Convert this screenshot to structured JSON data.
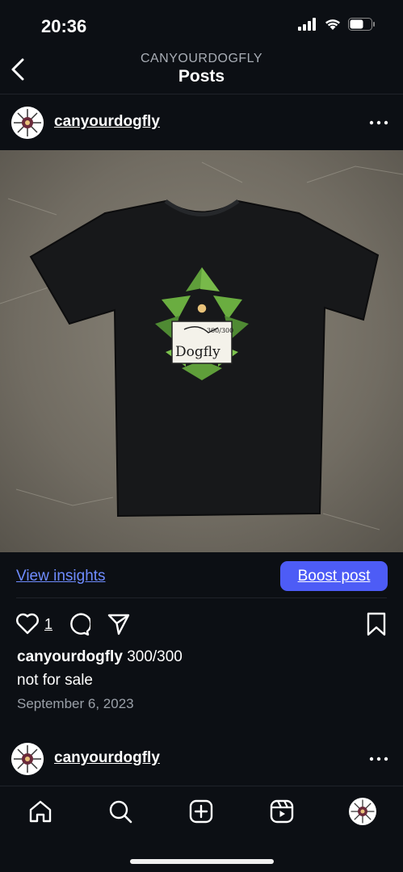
{
  "status_bar": {
    "time": "20:36"
  },
  "header": {
    "subtitle": "CANYOURDOGFLY",
    "title": "Posts"
  },
  "post": {
    "username": "canyourdogfly",
    "view_insights": "View insights",
    "boost_post": "Boost post",
    "like_count": "1",
    "caption_user": "canyourdogfly",
    "caption_text": "300/300",
    "caption_line2": "not for sale",
    "date": "September 6, 2023",
    "image_text": {
      "brand": "Dogfly",
      "edition": "300/300"
    }
  },
  "next_post": {
    "username": "canyourdogfly"
  },
  "icons": {
    "back": "chevron-left-icon",
    "more": "more-horizontal-icon",
    "like": "heart-icon",
    "comment": "comment-icon",
    "share": "send-icon",
    "save": "bookmark-icon",
    "home": "home-icon",
    "search": "search-icon",
    "create": "plus-square-icon",
    "reels": "reels-icon",
    "profile": "profile-avatar"
  },
  "colors": {
    "background": "#0c0f14",
    "link": "#6f8cff",
    "boost": "#4d5cf6",
    "muted": "#9aa0a8"
  }
}
